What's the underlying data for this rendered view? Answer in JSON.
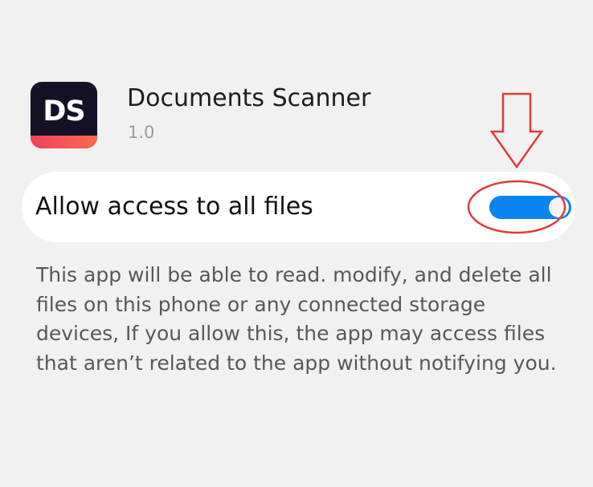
{
  "app": {
    "icon_label": "DS",
    "name": "Documents Scanner",
    "version": "1.0"
  },
  "setting": {
    "label": "Allow access to all files",
    "enabled": true
  },
  "description": "This app will be able to read. modify, and delete all files on this phone or any connected storage devices, If you allow this, the app may access files that aren’t related to the app without notifying you.",
  "colors": {
    "toggle_on": "#0a84ee",
    "annotation": "#e23a3a",
    "icon_bg": "#141127",
    "icon_stripe": "#f2405d"
  }
}
